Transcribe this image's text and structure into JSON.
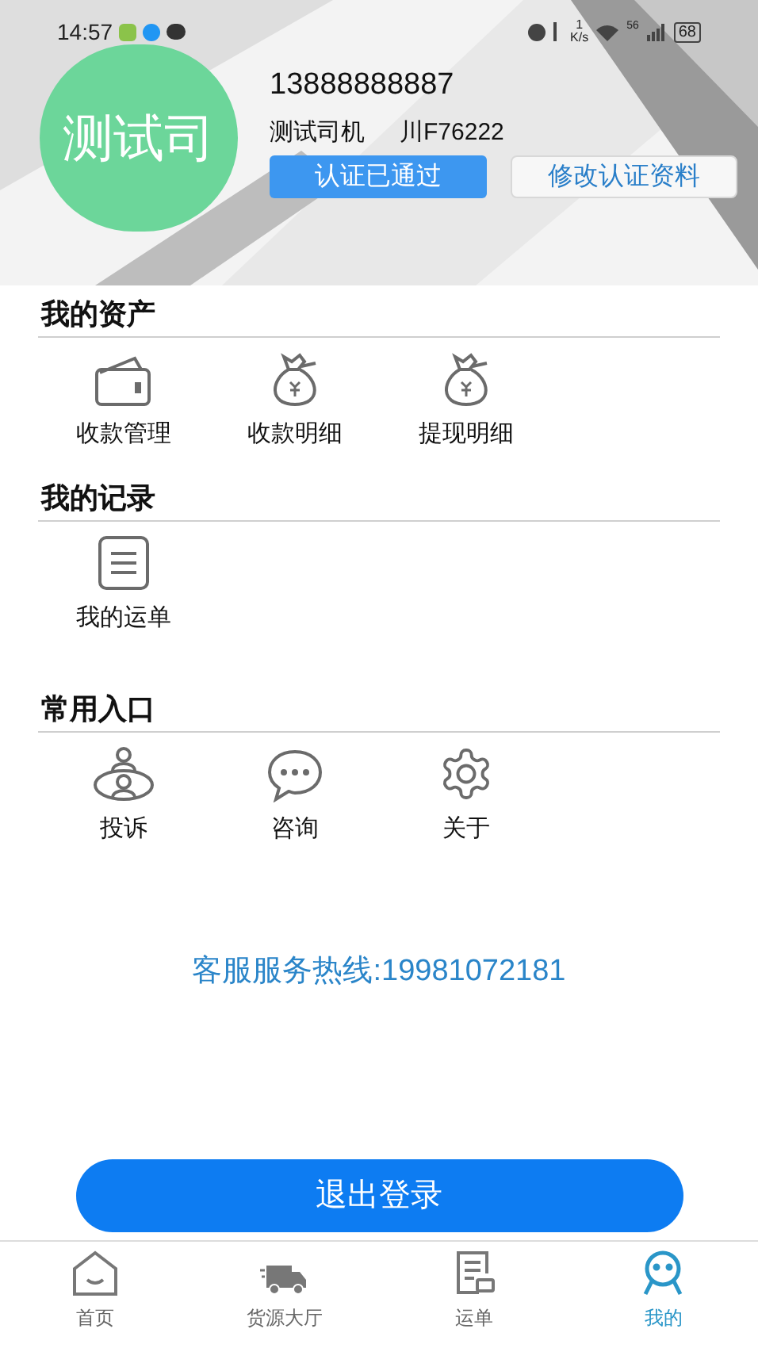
{
  "status_bar": {
    "time": "14:57",
    "speed_value": "1",
    "speed_unit": "K/s",
    "network": "56",
    "battery": "68"
  },
  "profile": {
    "avatar_text": "测试司",
    "phone": "13888888887",
    "name": "测试司机",
    "plate": "川F76222",
    "verified_label": "认证已通过",
    "edit_button": "修改认证资料"
  },
  "sections": [
    {
      "title": "我的资产",
      "items": [
        {
          "kind": "wallet",
          "label": "收款管理"
        },
        {
          "kind": "money-bag",
          "label": "收款明细"
        },
        {
          "kind": "money-bag",
          "label": "提现明细"
        }
      ]
    },
    {
      "title": "我的记录",
      "items": [
        {
          "kind": "list",
          "label": "我的运单"
        }
      ]
    },
    {
      "title": "常用入口",
      "items": [
        {
          "kind": "person",
          "label": "投诉"
        },
        {
          "kind": "chat",
          "label": "咨询"
        },
        {
          "kind": "gear",
          "label": "关于"
        }
      ]
    }
  ],
  "hotline": "客服服务热线:19981072181",
  "logout_button": "退出登录",
  "tabs": [
    {
      "kind": "home",
      "label": "首页",
      "selected": false
    },
    {
      "kind": "truck",
      "label": "货源大厅",
      "selected": false
    },
    {
      "kind": "order",
      "label": "运单",
      "selected": false
    },
    {
      "kind": "me",
      "label": "我的",
      "selected": true
    }
  ]
}
